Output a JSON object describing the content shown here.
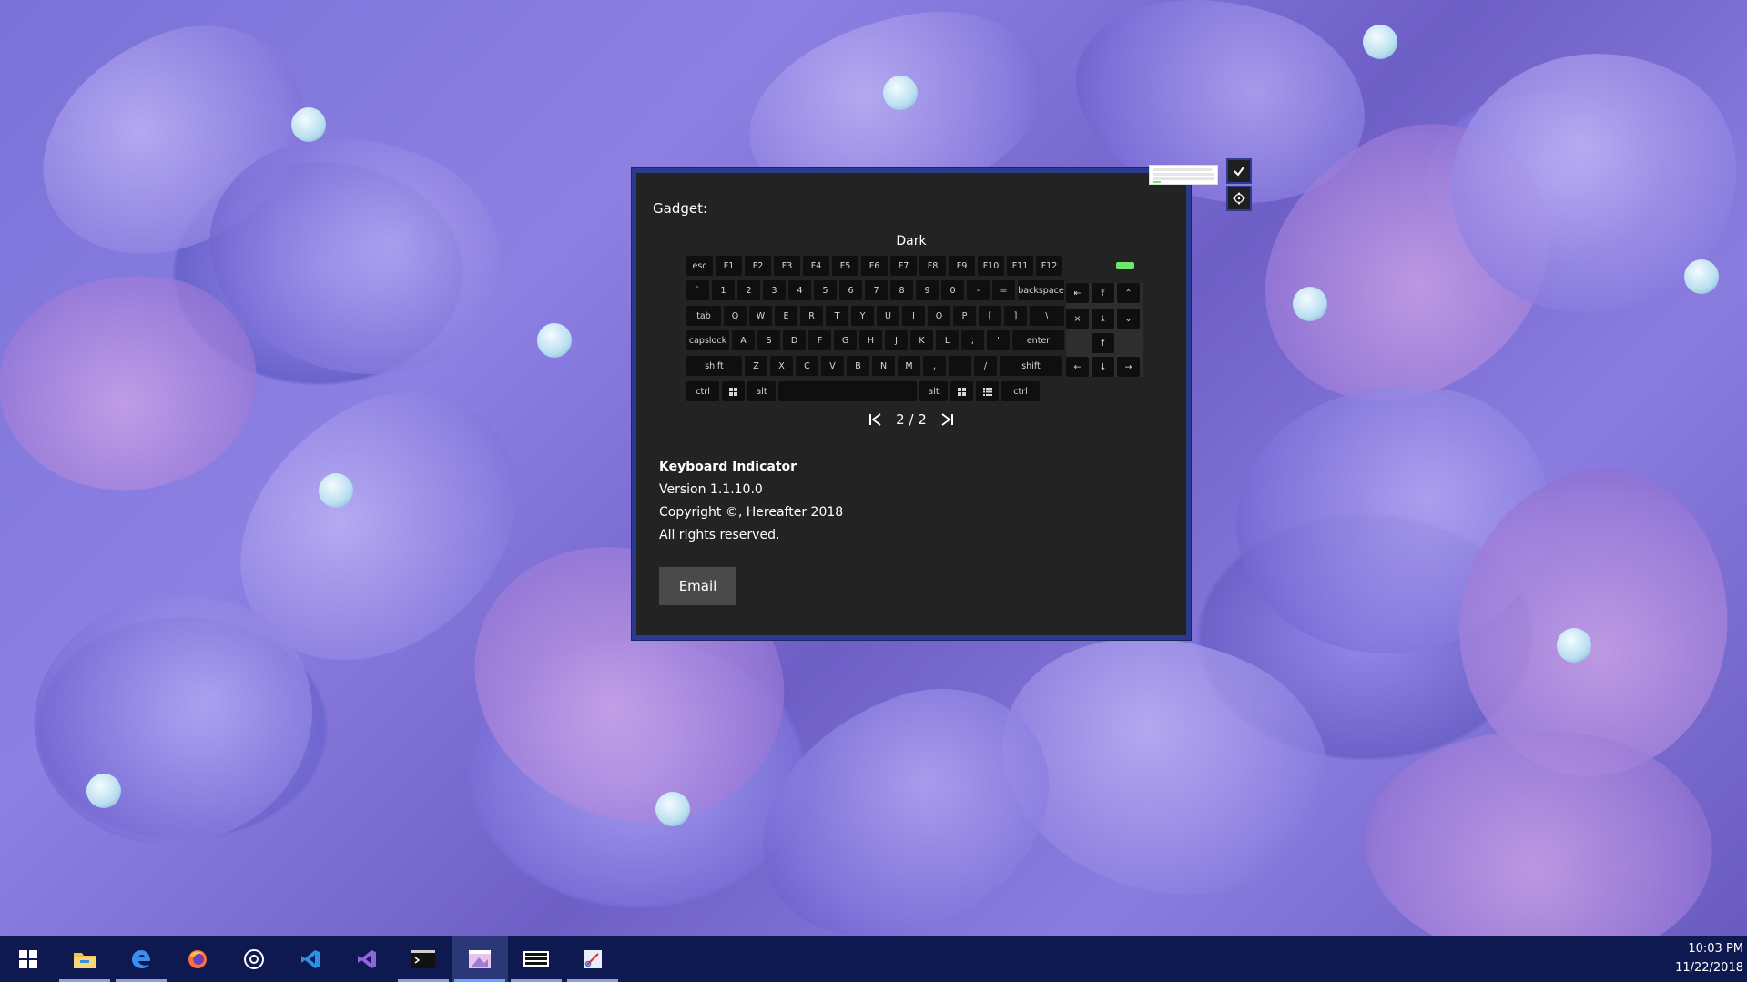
{
  "gadget": {
    "label": "Gadget:",
    "theme_name": "Dark",
    "keyboard": {
      "rows": [
        [
          "esc",
          "F1",
          "F2",
          "F3",
          "F4",
          "F5",
          "F6",
          "F7",
          "F8",
          "F9",
          "F10",
          "F11",
          "F12"
        ],
        [
          "`",
          "1",
          "2",
          "3",
          "4",
          "5",
          "6",
          "7",
          "8",
          "9",
          "0",
          "-",
          "=",
          "backspace"
        ],
        [
          "tab",
          "Q",
          "W",
          "E",
          "R",
          "T",
          "Y",
          "U",
          "I",
          "O",
          "P",
          "[",
          "]",
          "\\"
        ],
        [
          "capslock",
          "A",
          "S",
          "D",
          "F",
          "G",
          "H",
          "J",
          "K",
          "L",
          ";",
          "'",
          "enter"
        ],
        [
          "shift",
          "Z",
          "X",
          "C",
          "V",
          "B",
          "N",
          "M",
          ",",
          ".",
          "/",
          "shift"
        ],
        [
          "ctrl",
          "",
          "alt",
          "",
          "alt",
          "",
          "",
          "ctrl"
        ]
      ],
      "nav_rows": [
        [
          "⇤",
          "⤒",
          "⌃"
        ],
        [
          "⨯",
          "⤓",
          "⌄"
        ],
        [
          "",
          "↑",
          ""
        ],
        [
          "←",
          "↓",
          "→"
        ]
      ],
      "led_color": "#6fe46f"
    },
    "pager": {
      "current": "2 / 2"
    },
    "about": {
      "title": "Keyboard Indicator",
      "version": "Version 1.1.10.0",
      "copyright": "Copyright ©, Hereafter  2018",
      "rights": "All rights reserved."
    },
    "email_label": "Email",
    "border_color": "#2a3a8c",
    "background_color": "#232323"
  },
  "side_buttons": [
    {
      "icon": "checkmark-icon"
    },
    {
      "icon": "move-icon"
    }
  ],
  "taskbar": {
    "items": [
      {
        "icon": "windows-start-icon",
        "open": false
      },
      {
        "icon": "file-explorer-icon",
        "open": true
      },
      {
        "icon": "edge-icon",
        "open": true
      },
      {
        "icon": "firefox-icon",
        "open": false
      },
      {
        "icon": "groove-music-icon",
        "open": false
      },
      {
        "icon": "vscode-icon",
        "open": false
      },
      {
        "icon": "visual-studio-icon",
        "open": false
      },
      {
        "icon": "terminal-icon",
        "open": true
      },
      {
        "icon": "paint-icon",
        "open": true,
        "active": true
      },
      {
        "icon": "keyboard-icon",
        "open": true
      },
      {
        "icon": "snipping-icon",
        "open": true
      }
    ],
    "clock": {
      "time": "10:03 PM",
      "date": "11/22/2018"
    },
    "color": "#0e1a4f"
  }
}
